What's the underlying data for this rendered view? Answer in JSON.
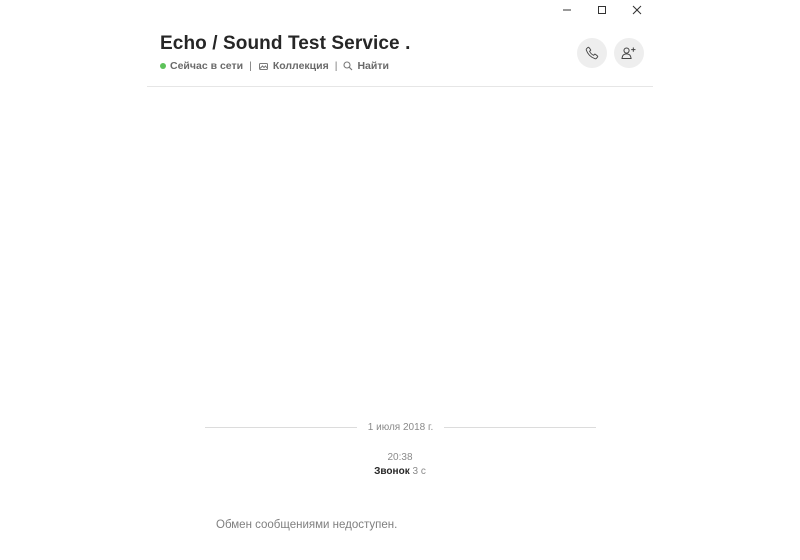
{
  "window": {
    "controls": [
      {
        "name": "minimize",
        "icon": "minimize-icon"
      },
      {
        "name": "maximize",
        "icon": "maximize-icon"
      },
      {
        "name": "close",
        "icon": "close-icon"
      }
    ]
  },
  "header": {
    "title": "Echo / Sound Test Service .",
    "status": {
      "label": "Сейчас в сети",
      "color": "#5dc25a"
    },
    "separator": "|",
    "gallery": {
      "label": "Коллекция",
      "icon": "gallery-icon"
    },
    "search": {
      "label": "Найти",
      "icon": "search-icon"
    },
    "call_button": {
      "icon": "phone-icon"
    },
    "add_button": {
      "icon": "add-user-icon"
    }
  },
  "conversation": {
    "date": "1 июля 2018 г.",
    "call": {
      "time": "20:38",
      "label": "Звонок",
      "duration": "3 с"
    },
    "notice": "Обмен сообщениями недоступен."
  }
}
